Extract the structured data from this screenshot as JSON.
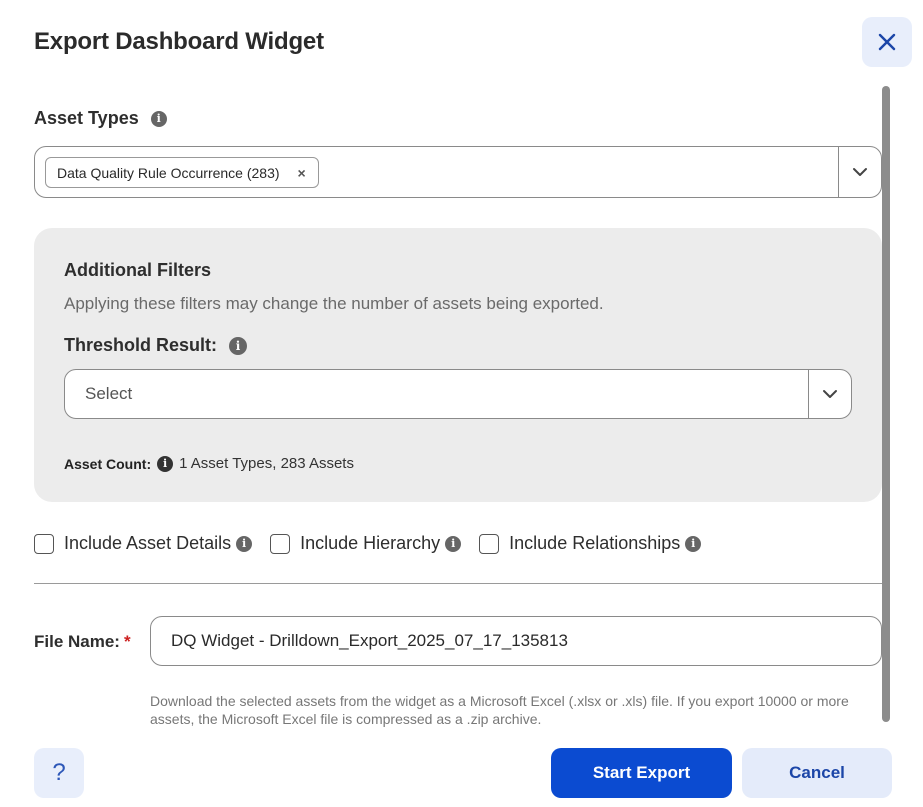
{
  "dialog": {
    "title": "Export Dashboard Widget"
  },
  "asset_types": {
    "label": "Asset Types",
    "selected_chip": "Data Quality Rule Occurrence (283)",
    "chip_remove": "×"
  },
  "filters": {
    "title": "Additional Filters",
    "description": "Applying these filters may change the number of assets being exported.",
    "threshold_label": "Threshold Result:",
    "threshold_placeholder": "Select",
    "asset_count_label": "Asset Count:",
    "asset_count_value": "1 Asset Types,  283 Assets"
  },
  "options": {
    "include_asset_details": "Include Asset Details",
    "include_hierarchy": "Include Hierarchy",
    "include_relationships": "Include Relationships"
  },
  "file": {
    "label": "File Name:",
    "required_marker": "*",
    "value": "DQ Widget - Drilldown_Export_2025_07_17_135813",
    "help": "Download the selected assets from the widget as a Microsoft Excel (.xlsx or .xls) file. If you export 10000 or more assets, the Microsoft Excel file is compressed as a .zip archive."
  },
  "footer": {
    "help_label": "?",
    "start_label": "Start Export",
    "cancel_label": "Cancel"
  },
  "icons": {
    "close": "close-icon",
    "info": "info-icon",
    "chevron": "chevron-down-icon",
    "help": "question-icon"
  },
  "colors": {
    "primary": "#0b4bd1",
    "secondary_bg": "#e4ebfa",
    "panel_bg": "#ececec",
    "required": "#cc1f1f"
  }
}
